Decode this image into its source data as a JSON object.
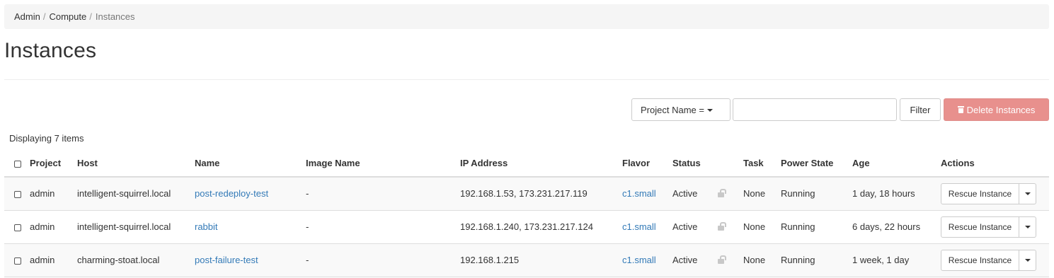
{
  "breadcrumb": {
    "items": [
      "Admin",
      "Compute"
    ],
    "separator": "/",
    "current": "Instances"
  },
  "page": {
    "title": "Instances"
  },
  "toolbar": {
    "filter_field_label": "Project Name =",
    "filter_value": "",
    "filter_button": "Filter",
    "delete_button": "Delete Instances",
    "delete_color": "#e8908d"
  },
  "table": {
    "count_text": "Displaying 7 items",
    "columns": [
      "Project",
      "Host",
      "Name",
      "Image Name",
      "IP Address",
      "Flavor",
      "Status",
      "Task",
      "Power State",
      "Age",
      "Actions"
    ],
    "rows": [
      {
        "project": "admin",
        "host": "intelligent-squirrel.local",
        "name": "post-redeploy-test",
        "image": "-",
        "ip": "192.168.1.53, 173.231.217.119",
        "flavor": "c1.small",
        "status": "Active",
        "lock_icon": "unlocked-icon",
        "task": "None",
        "power": "Running",
        "age": "1 day, 18 hours",
        "action": "Rescue Instance"
      },
      {
        "project": "admin",
        "host": "intelligent-squirrel.local",
        "name": "rabbit",
        "image": "-",
        "ip": "192.168.1.240, 173.231.217.124",
        "flavor": "c1.small",
        "status": "Active",
        "lock_icon": "unlocked-icon",
        "task": "None",
        "power": "Running",
        "age": "6 days, 22 hours",
        "action": "Rescue Instance"
      },
      {
        "project": "admin",
        "host": "charming-stoat.local",
        "name": "post-failure-test",
        "image": "-",
        "ip": "192.168.1.215",
        "flavor": "c1.small",
        "status": "Active",
        "lock_icon": "unlocked-icon",
        "task": "None",
        "power": "Running",
        "age": "1 week, 1 day",
        "action": "Rescue Instance"
      }
    ]
  },
  "colors": {
    "link": "#337ab7",
    "stripe": "#f9f9f9"
  }
}
